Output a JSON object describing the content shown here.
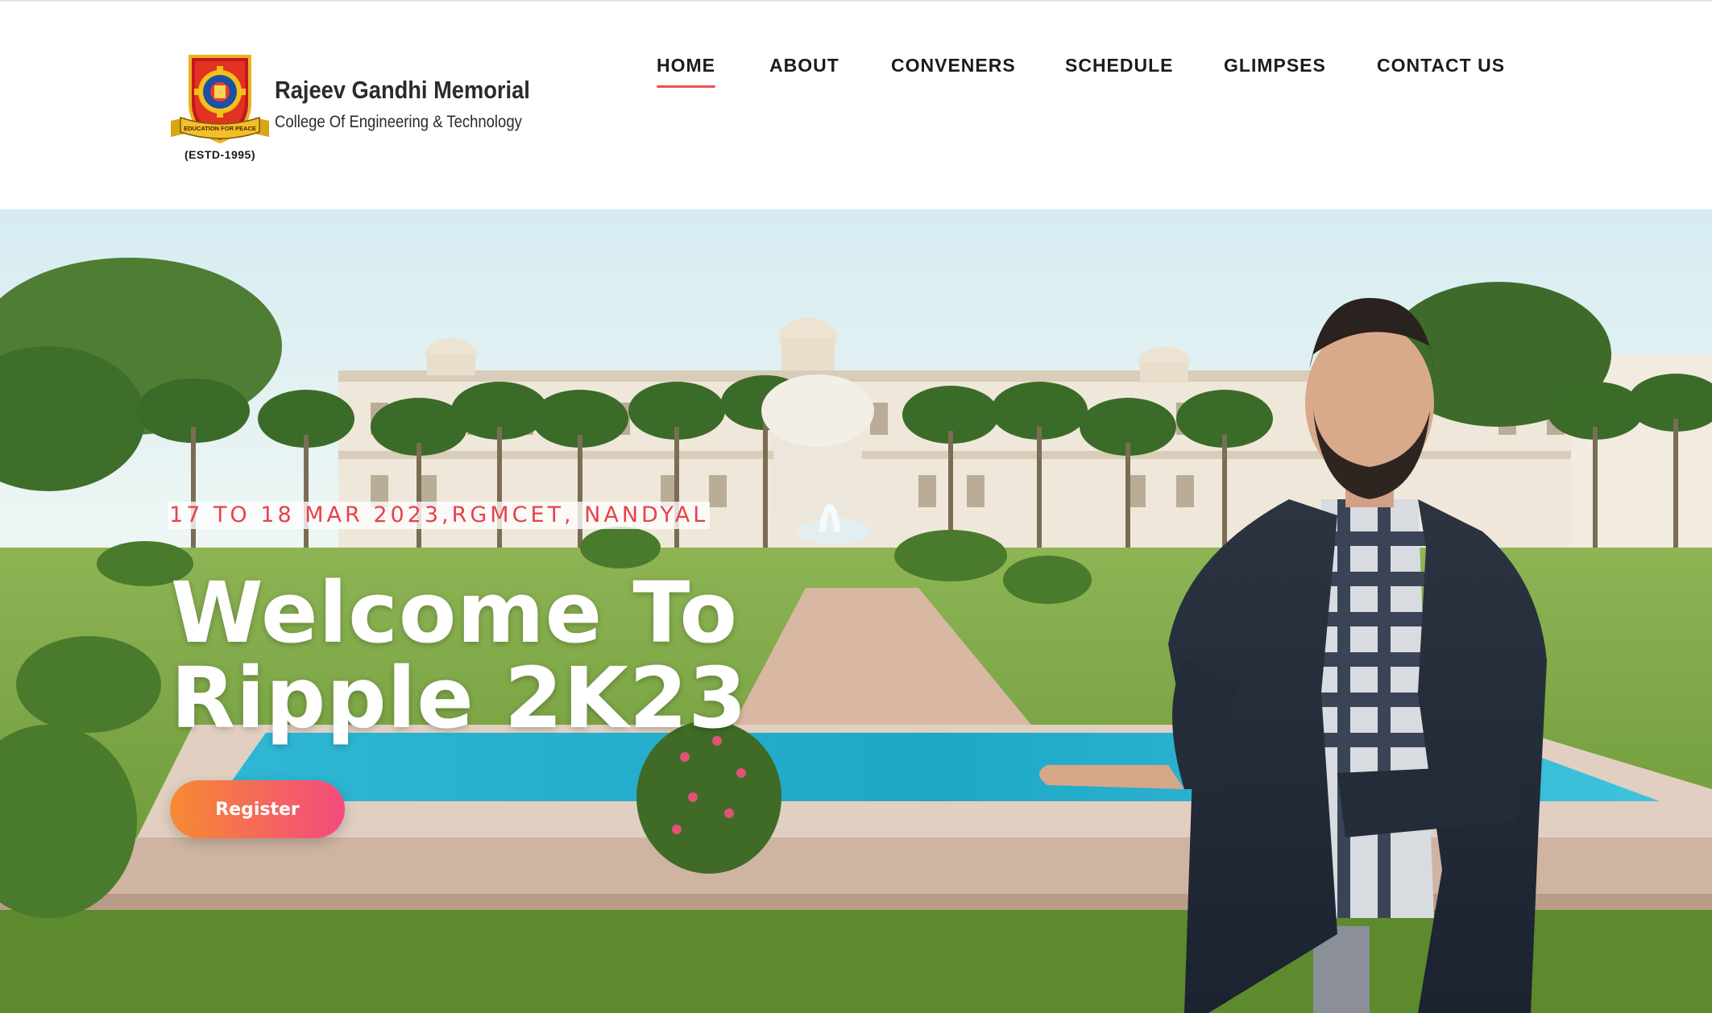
{
  "header": {
    "logo_caption": "(ESTD-1995)",
    "logo_ribbon_text": "EDUCATION FOR PEACE",
    "brand_name": "Rajeev Gandhi Memorial",
    "brand_subtitle": "College Of Engineering & Technology"
  },
  "nav": {
    "items": [
      {
        "label": "HOME",
        "active": true
      },
      {
        "label": "ABOUT",
        "active": false
      },
      {
        "label": "CONVENERS",
        "active": false
      },
      {
        "label": "SCHEDULE",
        "active": false
      },
      {
        "label": "GLIMPSES",
        "active": false
      },
      {
        "label": "CONTACT US",
        "active": false
      }
    ]
  },
  "hero": {
    "event_date": "17 TO 18 MAR 2023,RGMCET, NANDYAL",
    "title_line1": "Welcome To",
    "title_line2": "Ripple 2K23",
    "register_label": "Register",
    "background_image": "campus-with-fountain-and-palm-trees",
    "presenter_image": "bearded-man-in-blazer-presenting"
  },
  "colors": {
    "accent": "#f14d55",
    "date_text": "#e8414b",
    "button_gradient_start": "#f68a32",
    "button_gradient_end": "#f44a7e",
    "nav_text": "#1c1c1c"
  }
}
